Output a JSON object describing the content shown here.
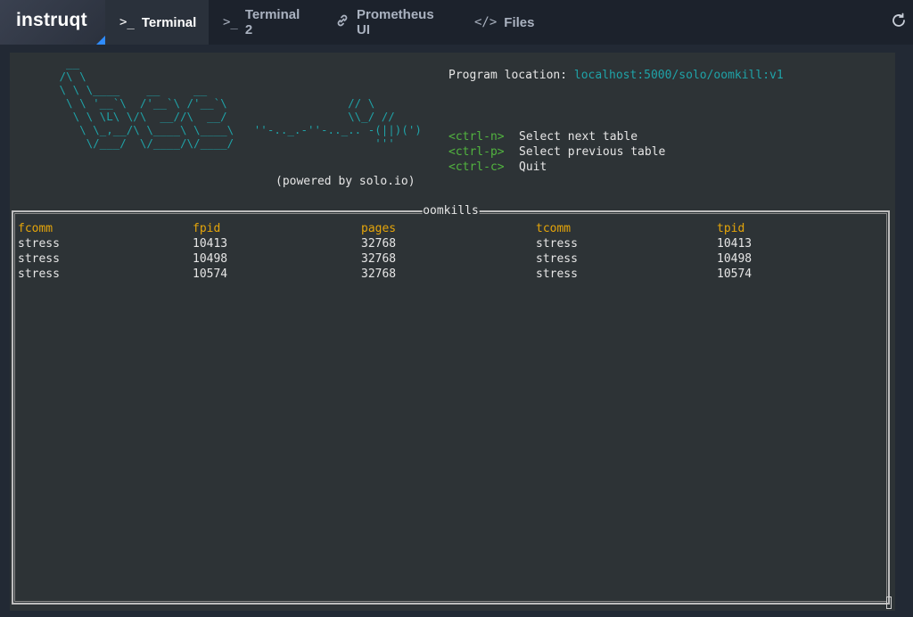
{
  "brand": {
    "logo": "instruqt"
  },
  "tabs": [
    {
      "label": "Terminal",
      "icon": "terminal-icon",
      "glyph": ">_",
      "active": true
    },
    {
      "label": "Terminal 2",
      "icon": "terminal-icon",
      "glyph": ">_",
      "active": false
    },
    {
      "label": "Prometheus UI",
      "icon": "link-icon",
      "glyph": "🔗",
      "active": false
    },
    {
      "label": "Files",
      "icon": "code-icon",
      "glyph": "</>",
      "active": false
    }
  ],
  "refresh_icon": "refresh-icon",
  "terminal": {
    "ascii_art": "  __\n /\\ \\\n \\ \\ \\____    __     __\n  \\ \\ '__`\\  /'__`\\ /'__`\\                  // \\\n   \\ \\ \\L\\ \\/\\  __//\\  __/                  \\\\_/ //\n    \\ \\_,__/\\ \\____\\ \\____\\   ''-.._.-''-.._.. -(||)(')\n     \\/___/  \\/____/\\/____/                     '''",
    "powered_by": "(powered by solo.io)",
    "program_location_label": "Program location:",
    "program_location_value": "localhost:5000/solo/oomkill:v1",
    "shortcuts": [
      {
        "key": "<ctrl-n>",
        "desc": "Select next table"
      },
      {
        "key": "<ctrl-p>",
        "desc": "Select previous table"
      },
      {
        "key": "<ctrl-c>",
        "desc": "Quit"
      }
    ],
    "table": {
      "title": "oomkills",
      "columns": [
        "fcomm",
        "fpid",
        "pages",
        "tcomm",
        "tpid"
      ],
      "rows": [
        [
          "stress",
          "10413",
          "32768",
          "stress",
          "10413"
        ],
        [
          "stress",
          "10498",
          "32768",
          "stress",
          "10498"
        ],
        [
          "stress",
          "10574",
          "32768",
          "stress",
          "10574"
        ]
      ]
    }
  },
  "colors": {
    "accent": "#2f8cff",
    "header": "#e5a50a",
    "ascii": "#1fa3a8",
    "key": "#52b43f"
  }
}
